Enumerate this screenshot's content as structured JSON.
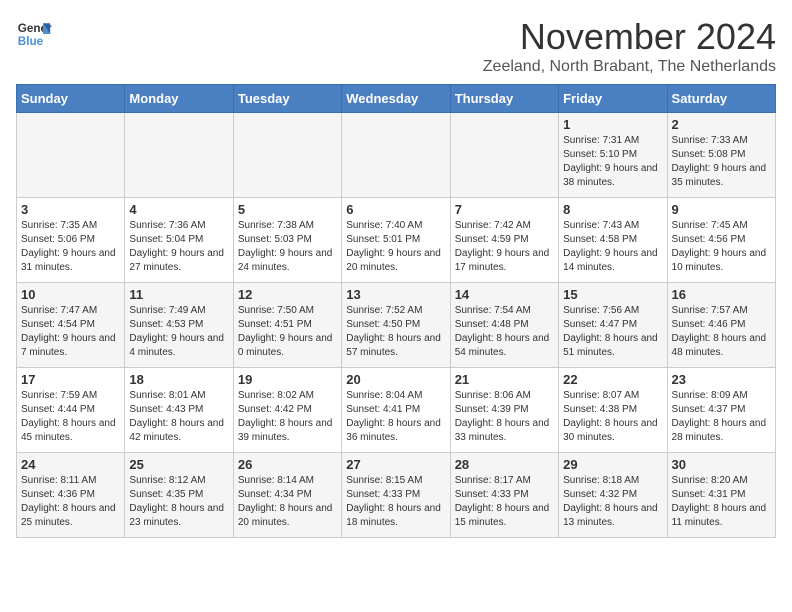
{
  "logo": {
    "line1": "General",
    "line2": "Blue"
  },
  "title": "November 2024",
  "subtitle": "Zeeland, North Brabant, The Netherlands",
  "days_of_week": [
    "Sunday",
    "Monday",
    "Tuesday",
    "Wednesday",
    "Thursday",
    "Friday",
    "Saturday"
  ],
  "weeks": [
    [
      {
        "day": "",
        "info": ""
      },
      {
        "day": "",
        "info": ""
      },
      {
        "day": "",
        "info": ""
      },
      {
        "day": "",
        "info": ""
      },
      {
        "day": "",
        "info": ""
      },
      {
        "day": "1",
        "info": "Sunrise: 7:31 AM\nSunset: 5:10 PM\nDaylight: 9 hours\nand 38 minutes."
      },
      {
        "day": "2",
        "info": "Sunrise: 7:33 AM\nSunset: 5:08 PM\nDaylight: 9 hours\nand 35 minutes."
      }
    ],
    [
      {
        "day": "3",
        "info": "Sunrise: 7:35 AM\nSunset: 5:06 PM\nDaylight: 9 hours\nand 31 minutes."
      },
      {
        "day": "4",
        "info": "Sunrise: 7:36 AM\nSunset: 5:04 PM\nDaylight: 9 hours\nand 27 minutes."
      },
      {
        "day": "5",
        "info": "Sunrise: 7:38 AM\nSunset: 5:03 PM\nDaylight: 9 hours\nand 24 minutes."
      },
      {
        "day": "6",
        "info": "Sunrise: 7:40 AM\nSunset: 5:01 PM\nDaylight: 9 hours\nand 20 minutes."
      },
      {
        "day": "7",
        "info": "Sunrise: 7:42 AM\nSunset: 4:59 PM\nDaylight: 9 hours\nand 17 minutes."
      },
      {
        "day": "8",
        "info": "Sunrise: 7:43 AM\nSunset: 4:58 PM\nDaylight: 9 hours\nand 14 minutes."
      },
      {
        "day": "9",
        "info": "Sunrise: 7:45 AM\nSunset: 4:56 PM\nDaylight: 9 hours\nand 10 minutes."
      }
    ],
    [
      {
        "day": "10",
        "info": "Sunrise: 7:47 AM\nSunset: 4:54 PM\nDaylight: 9 hours\nand 7 minutes."
      },
      {
        "day": "11",
        "info": "Sunrise: 7:49 AM\nSunset: 4:53 PM\nDaylight: 9 hours\nand 4 minutes."
      },
      {
        "day": "12",
        "info": "Sunrise: 7:50 AM\nSunset: 4:51 PM\nDaylight: 9 hours\nand 0 minutes."
      },
      {
        "day": "13",
        "info": "Sunrise: 7:52 AM\nSunset: 4:50 PM\nDaylight: 8 hours\nand 57 minutes."
      },
      {
        "day": "14",
        "info": "Sunrise: 7:54 AM\nSunset: 4:48 PM\nDaylight: 8 hours\nand 54 minutes."
      },
      {
        "day": "15",
        "info": "Sunrise: 7:56 AM\nSunset: 4:47 PM\nDaylight: 8 hours\nand 51 minutes."
      },
      {
        "day": "16",
        "info": "Sunrise: 7:57 AM\nSunset: 4:46 PM\nDaylight: 8 hours\nand 48 minutes."
      }
    ],
    [
      {
        "day": "17",
        "info": "Sunrise: 7:59 AM\nSunset: 4:44 PM\nDaylight: 8 hours\nand 45 minutes."
      },
      {
        "day": "18",
        "info": "Sunrise: 8:01 AM\nSunset: 4:43 PM\nDaylight: 8 hours\nand 42 minutes."
      },
      {
        "day": "19",
        "info": "Sunrise: 8:02 AM\nSunset: 4:42 PM\nDaylight: 8 hours\nand 39 minutes."
      },
      {
        "day": "20",
        "info": "Sunrise: 8:04 AM\nSunset: 4:41 PM\nDaylight: 8 hours\nand 36 minutes."
      },
      {
        "day": "21",
        "info": "Sunrise: 8:06 AM\nSunset: 4:39 PM\nDaylight: 8 hours\nand 33 minutes."
      },
      {
        "day": "22",
        "info": "Sunrise: 8:07 AM\nSunset: 4:38 PM\nDaylight: 8 hours\nand 30 minutes."
      },
      {
        "day": "23",
        "info": "Sunrise: 8:09 AM\nSunset: 4:37 PM\nDaylight: 8 hours\nand 28 minutes."
      }
    ],
    [
      {
        "day": "24",
        "info": "Sunrise: 8:11 AM\nSunset: 4:36 PM\nDaylight: 8 hours\nand 25 minutes."
      },
      {
        "day": "25",
        "info": "Sunrise: 8:12 AM\nSunset: 4:35 PM\nDaylight: 8 hours\nand 23 minutes."
      },
      {
        "day": "26",
        "info": "Sunrise: 8:14 AM\nSunset: 4:34 PM\nDaylight: 8 hours\nand 20 minutes."
      },
      {
        "day": "27",
        "info": "Sunrise: 8:15 AM\nSunset: 4:33 PM\nDaylight: 8 hours\nand 18 minutes."
      },
      {
        "day": "28",
        "info": "Sunrise: 8:17 AM\nSunset: 4:33 PM\nDaylight: 8 hours\nand 15 minutes."
      },
      {
        "day": "29",
        "info": "Sunrise: 8:18 AM\nSunset: 4:32 PM\nDaylight: 8 hours\nand 13 minutes."
      },
      {
        "day": "30",
        "info": "Sunrise: 8:20 AM\nSunset: 4:31 PM\nDaylight: 8 hours\nand 11 minutes."
      }
    ]
  ]
}
